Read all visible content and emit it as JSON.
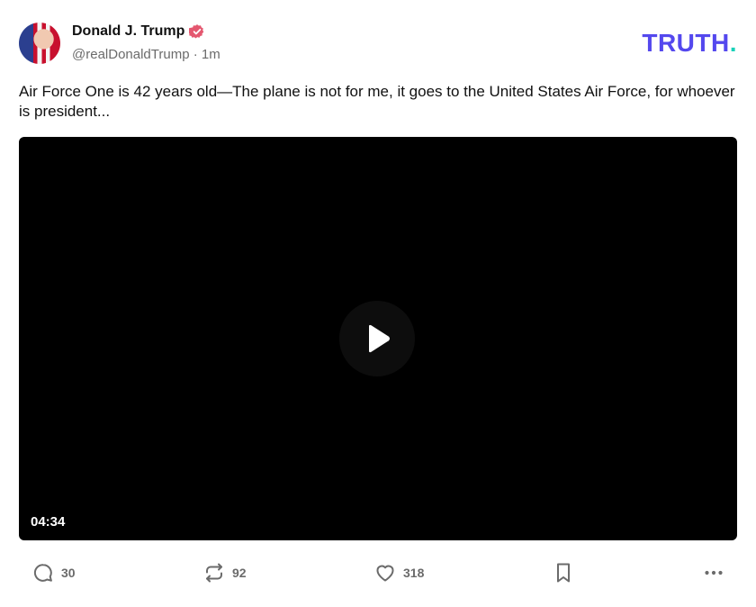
{
  "post": {
    "display_name": "Donald J. Trump",
    "handle": "@realDonaldTrump",
    "separator": "·",
    "time": "1m",
    "text": "Air Force One is 42 years old—The plane is not for me, it goes to the United States Air Force, for whoever is president...",
    "verified_icon": "verified-badge-icon",
    "avatar_icon": "avatar"
  },
  "brand": {
    "logo_text": "TRUTH",
    "logo_dot": ".",
    "logo_color": "#5448ee",
    "dot_color": "#18d1b9"
  },
  "video": {
    "duration": "04:34",
    "play_icon": "play-icon"
  },
  "actions": {
    "reply": {
      "icon": "reply-icon",
      "count": "30"
    },
    "retruth": {
      "icon": "retruth-icon",
      "count": "92"
    },
    "like": {
      "icon": "heart-icon",
      "count": "318"
    },
    "bookmark": {
      "icon": "bookmark-icon"
    },
    "more": {
      "icon": "more-icon"
    }
  }
}
